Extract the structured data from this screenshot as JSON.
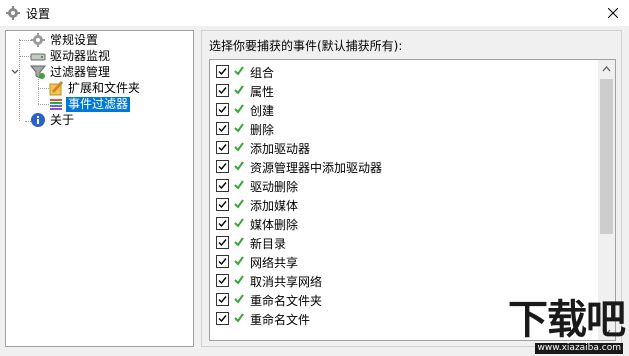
{
  "window": {
    "title": "设置"
  },
  "tree": {
    "items": [
      {
        "label": "常规设置",
        "icon": "gear-icon"
      },
      {
        "label": "驱动器监视",
        "icon": "drive-icon"
      },
      {
        "label": "过滤器管理",
        "icon": "funnel-icon",
        "expanded": true
      },
      {
        "label": "扩展和文件夹",
        "icon": "pencil-folder-icon"
      },
      {
        "label": "事件过滤器",
        "icon": "event-filter-icon",
        "selected": true
      },
      {
        "label": "关于",
        "icon": "info-icon"
      }
    ]
  },
  "events_group": {
    "label": "选择你要捕获的事件(默认捕获所有):",
    "items": [
      {
        "label": "组合",
        "checked": true
      },
      {
        "label": "属性",
        "checked": true
      },
      {
        "label": "创建",
        "checked": true
      },
      {
        "label": "删除",
        "checked": true
      },
      {
        "label": "添加驱动器",
        "checked": true
      },
      {
        "label": "资源管理器中添加驱动器",
        "checked": true
      },
      {
        "label": "驱动删除",
        "checked": true
      },
      {
        "label": "添加媒体",
        "checked": true
      },
      {
        "label": "媒体删除",
        "checked": true
      },
      {
        "label": "新目录",
        "checked": true
      },
      {
        "label": "网络共享",
        "checked": true
      },
      {
        "label": "取消共享网络",
        "checked": true
      },
      {
        "label": "重命名文件夹",
        "checked": true
      },
      {
        "label": "重命名文件",
        "checked": true
      }
    ]
  },
  "watermark": {
    "brand": "下载吧",
    "url": "www.xiazaiba.com"
  },
  "colors": {
    "selection": "#0078d7",
    "tick_green": "#3aa63a"
  }
}
